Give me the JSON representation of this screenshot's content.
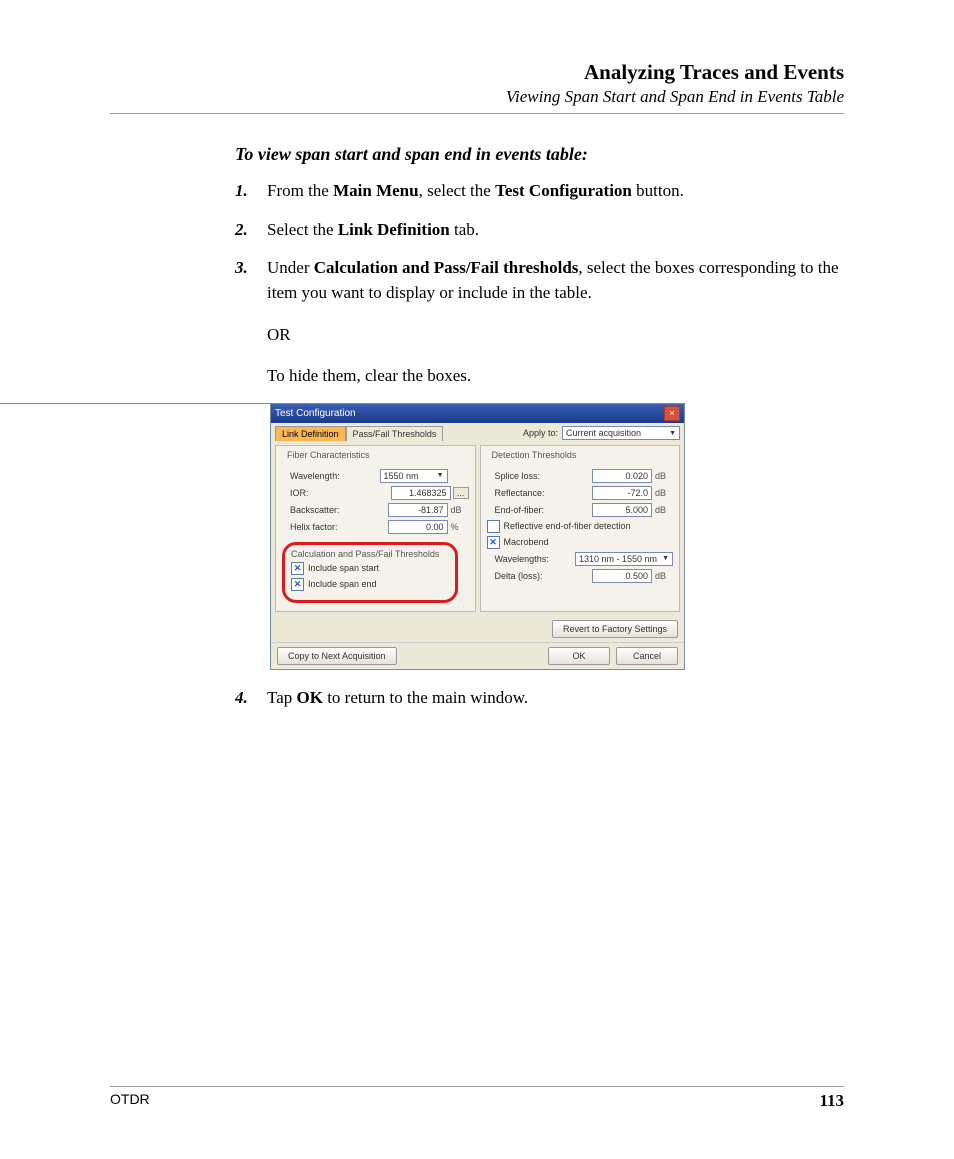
{
  "header": {
    "title": "Analyzing Traces and Events",
    "subtitle": "Viewing Span Start and Span End in Events Table"
  },
  "lead": "To view span start and span end in events table:",
  "steps": {
    "s1": {
      "n": "1.",
      "pre": "From the ",
      "b1": "Main Menu",
      "mid": ", select the ",
      "b2": "Test Configuration",
      "post": " button."
    },
    "s2": {
      "n": "2.",
      "pre": "Select the ",
      "b1": "Link Definition",
      "post": " tab."
    },
    "s3": {
      "n": "3.",
      "pre": "Under ",
      "b1": "Calculation and Pass/Fail thresholds",
      "post": ", select the boxes corresponding to the item you want to display or include in the table."
    },
    "s3or": "OR",
    "s3b": "To hide them, clear the boxes.",
    "s4": {
      "n": "4.",
      "pre": "Tap ",
      "b1": "OK",
      "post": " to return to the main window."
    }
  },
  "dialog": {
    "title": "Test Configuration",
    "tabs": {
      "link": "Link Definition",
      "pf": "Pass/Fail Thresholds"
    },
    "apply_label": "Apply to:",
    "apply_value": "Current acquisition",
    "left_title": "Fiber Characteristics",
    "left": {
      "wavelength_l": "Wavelength:",
      "wavelength_v": "1550 nm",
      "ior_l": "IOR:",
      "ior_v": "1.468325",
      "back_l": "Backscatter:",
      "back_v": "-81.87",
      "back_u": "dB",
      "helix_l": "Helix factor:",
      "helix_v": "0.00",
      "helix_u": "%"
    },
    "calc": {
      "title": "Calculation and Pass/Fail Thresholds",
      "c1": "Include span start",
      "c2": "Include span end"
    },
    "right_title": "Detection Thresholds",
    "right": {
      "splice_l": "Splice loss:",
      "splice_v": "0.020",
      "u": "dB",
      "refl_l": "Reflectance:",
      "refl_v": "-72.0",
      "eof_l": "End-of-fiber:",
      "eof_v": "5.000",
      "refeof": "Reflective end-of-fiber detection",
      "macro": "Macrobend",
      "wl_l": "Wavelengths:",
      "wl_v": "1310 nm - 1550 nm",
      "delta_l": "Delta (loss):",
      "delta_v": "0.500"
    },
    "buttons": {
      "revert": "Revert to Factory Settings",
      "copy": "Copy to Next Acquisition",
      "ok": "OK",
      "cancel": "Cancel"
    }
  },
  "footer": {
    "left": "OTDR",
    "right": "113"
  }
}
